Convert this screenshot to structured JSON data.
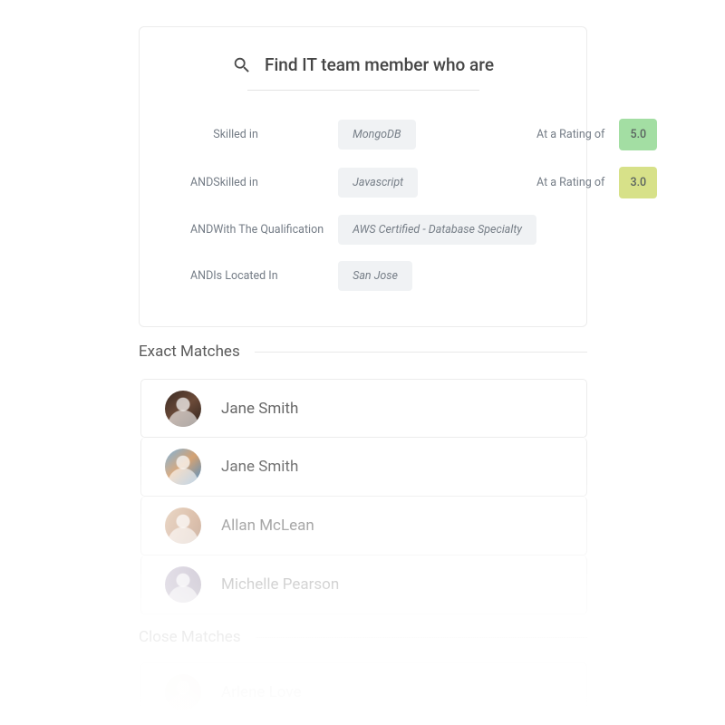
{
  "search": {
    "placeholder": "Find IT team member who are"
  },
  "criteria": {
    "and_label": "AND",
    "skilled_in_label": "Skilled in",
    "rating_label": "At a Rating of",
    "qualification_label": "With The Qualification",
    "location_label": "Is Located In",
    "rows": [
      {
        "and": "",
        "kind": "skill",
        "value": "MongoDB",
        "rating": "5.0",
        "rating_color": "green"
      },
      {
        "and": "AND",
        "kind": "skill",
        "value": "Javascript",
        "rating": "3.0",
        "rating_color": "yellow"
      },
      {
        "and": "AND",
        "kind": "qualification",
        "value": "AWS Certified - Database Specialty"
      },
      {
        "and": "AND",
        "kind": "location",
        "value": "San Jose"
      }
    ]
  },
  "sections": {
    "exact": {
      "title": "Exact Matches",
      "results": [
        {
          "name": "Jane Smith",
          "avatar": "a"
        },
        {
          "name": "Jane Smith",
          "avatar": "b"
        },
        {
          "name": "Allan McLean",
          "avatar": "c"
        },
        {
          "name": "Michelle Pearson",
          "avatar": "d"
        }
      ]
    },
    "close": {
      "title": "Close Matches",
      "results": [
        {
          "name": "Arlene Love",
          "avatar": "e"
        }
      ]
    }
  }
}
